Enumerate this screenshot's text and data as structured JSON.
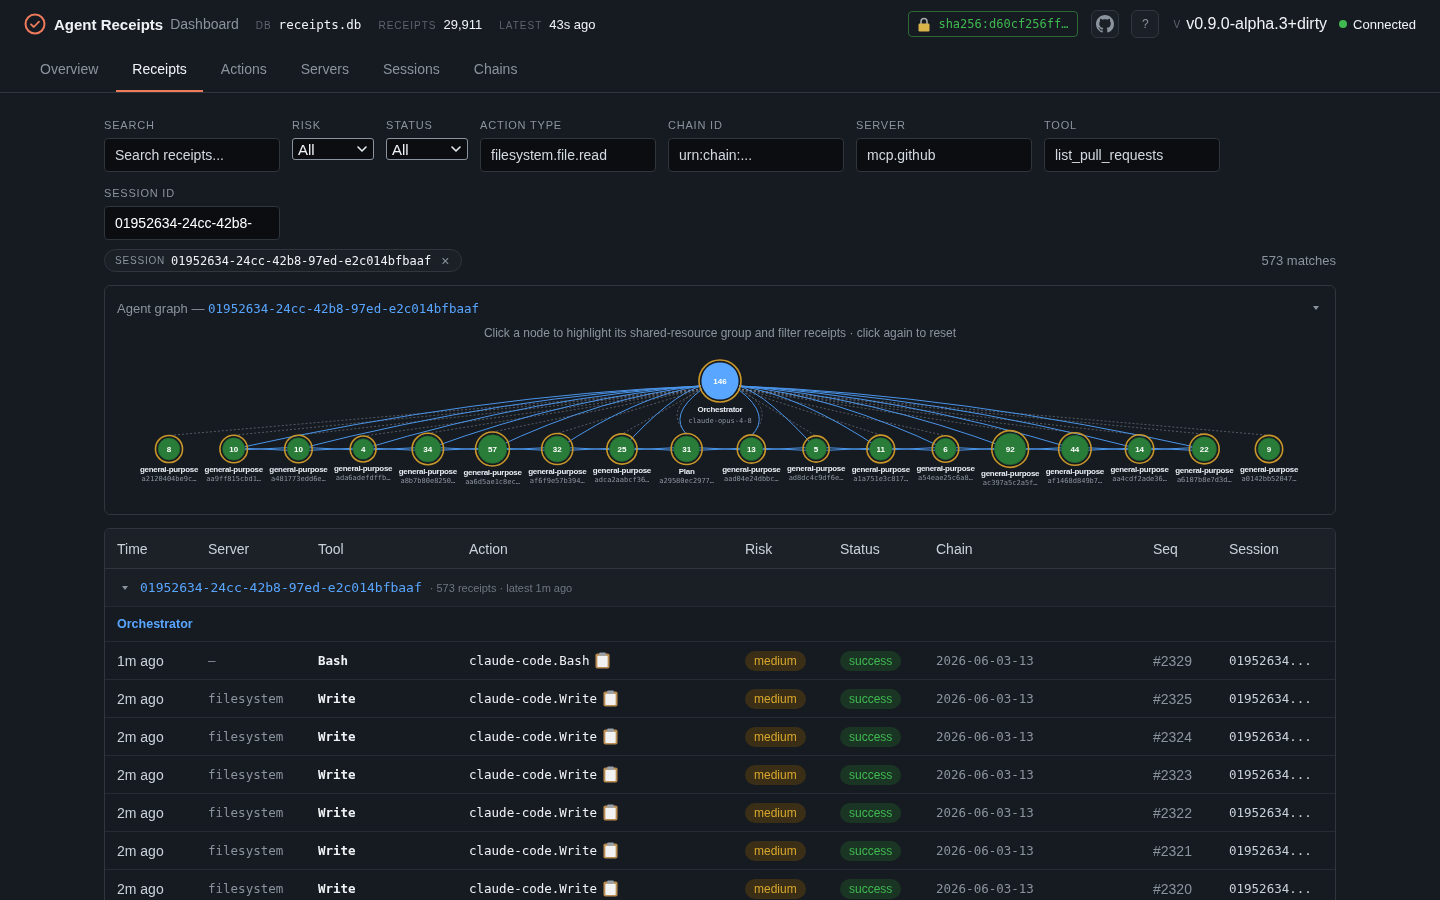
{
  "header": {
    "app_title": "Agent Receipts",
    "subtitle": "Dashboard",
    "stats": [
      {
        "label": "DB",
        "value": "receipts.db",
        "kind": "mono"
      },
      {
        "label": "RECEIPTS",
        "value": "29,911",
        "kind": "plain"
      },
      {
        "label": "LATEST",
        "value": "43s ago",
        "kind": "plain"
      }
    ],
    "hash": "sha256:d60cf256ff…",
    "help_button": "?",
    "version_label": "V",
    "version": "v0.9.0-alpha.3+dirty",
    "connection": {
      "label": "Connected",
      "connected": true
    }
  },
  "tabs": [
    {
      "label": "Overview",
      "selected": false
    },
    {
      "label": "Receipts",
      "selected": true
    },
    {
      "label": "Actions",
      "selected": false
    },
    {
      "label": "Servers",
      "selected": false
    },
    {
      "label": "Sessions",
      "selected": false
    },
    {
      "label": "Chains",
      "selected": false
    }
  ],
  "filters": [
    {
      "label": "SEARCH",
      "kind": "text",
      "placeholder": "Search receipts..."
    },
    {
      "label": "RISK",
      "kind": "select",
      "value": "All"
    },
    {
      "label": "STATUS",
      "kind": "select",
      "value": "All"
    },
    {
      "label": "ACTION TYPE",
      "kind": "text",
      "placeholder": "filesystem.file.read"
    },
    {
      "label": "CHAIN ID",
      "kind": "text",
      "placeholder": "urn:chain:..."
    },
    {
      "label": "SERVER",
      "kind": "text",
      "placeholder": "mcp.github"
    },
    {
      "label": "TOOL",
      "kind": "text",
      "placeholder": "list_pull_requests"
    },
    {
      "label": "SESSION ID",
      "kind": "text",
      "value": "01952634-24cc-42b8-"
    }
  ],
  "session_filter": {
    "label": "SESSION",
    "value": "01952634-24cc-42b8-97ed-e2c014bfbaaf",
    "remove": "×"
  },
  "match_count": "573 matches",
  "agent_graph": {
    "title": "Agent graph —",
    "session": "01952634-24cc-42b8-97ed-e2c014bfbaaf",
    "expanded": true,
    "hint": "Click a node to highlight its shared-resource group and filter receipts · click again to reset",
    "root": {
      "count": "146",
      "label": "Orchestrator",
      "model": "claude-opus-4-8"
    },
    "nodes": [
      {
        "count": "8",
        "label": "general-purpose",
        "id": "a2120404be9c…"
      },
      {
        "count": "10",
        "label": "general-purpose",
        "id": "aa9ff815cbd1…"
      },
      {
        "count": "10",
        "label": "general-purpose",
        "id": "a481773edd6e…"
      },
      {
        "count": "4",
        "label": "general-purpose",
        "id": "ada6adefdffb…"
      },
      {
        "count": "34",
        "label": "general-purpose",
        "id": "a8b7b80e8250…"
      },
      {
        "count": "57",
        "label": "general-purpose",
        "id": "aa6d5ae1c8ec…"
      },
      {
        "count": "32",
        "label": "general-purpose",
        "id": "af6f9e57b394…"
      },
      {
        "count": "25",
        "label": "general-purpose",
        "id": "adca2aabcf36…"
      },
      {
        "count": "31",
        "label": "Plan",
        "id": "a29580ec2977…"
      },
      {
        "count": "13",
        "label": "general-purpose",
        "id": "aad04e24dbbc…"
      },
      {
        "count": "5",
        "label": "general-purpose",
        "id": "ad8dc4c9df6e…"
      },
      {
        "count": "11",
        "label": "general-purpose",
        "id": "a1a751e3c817…"
      },
      {
        "count": "6",
        "label": "general-purpose",
        "id": "a54eae25c6a8…"
      },
      {
        "count": "92",
        "label": "general-purpose",
        "id": "ac397a5c2a5f…"
      },
      {
        "count": "44",
        "label": "general-purpose",
        "id": "af1468d849b7…"
      },
      {
        "count": "14",
        "label": "general-purpose",
        "id": "aa4cdf2ade36…"
      },
      {
        "count": "22",
        "label": "general-purpose",
        "id": "a6107b8e7d3d…"
      },
      {
        "count": "9",
        "label": "general-purpose",
        "id": "a0142bb52047…"
      }
    ]
  },
  "table": {
    "columns": [
      "Time",
      "Server",
      "Tool",
      "Action",
      "Risk",
      "Status",
      "Chain",
      "Seq",
      "Session"
    ],
    "groups": [
      {
        "session": "01952634-24cc-42b8-97ed-e2c014bfbaaf",
        "expanded": true,
        "meta": "· 573 receipts · latest 1m ago",
        "agents": [
          {
            "name": "Orchestrator",
            "rows": [
              {
                "time": "1m ago",
                "server": "—",
                "tool": "Bash",
                "action": "claude-code.Bash",
                "risk": "medium",
                "status": "success",
                "chain": "2026-06-03-13",
                "seq": "#2329",
                "session": "01952634..."
              },
              {
                "time": "2m ago",
                "server": "filesystem",
                "tool": "Write",
                "action": "claude-code.Write",
                "risk": "medium",
                "status": "success",
                "chain": "2026-06-03-13",
                "seq": "#2325",
                "session": "01952634..."
              },
              {
                "time": "2m ago",
                "server": "filesystem",
                "tool": "Write",
                "action": "claude-code.Write",
                "risk": "medium",
                "status": "success",
                "chain": "2026-06-03-13",
                "seq": "#2324",
                "session": "01952634..."
              },
              {
                "time": "2m ago",
                "server": "filesystem",
                "tool": "Write",
                "action": "claude-code.Write",
                "risk": "medium",
                "status": "success",
                "chain": "2026-06-03-13",
                "seq": "#2323",
                "session": "01952634..."
              },
              {
                "time": "2m ago",
                "server": "filesystem",
                "tool": "Write",
                "action": "claude-code.Write",
                "risk": "medium",
                "status": "success",
                "chain": "2026-06-03-13",
                "seq": "#2322",
                "session": "01952634..."
              },
              {
                "time": "2m ago",
                "server": "filesystem",
                "tool": "Write",
                "action": "claude-code.Write",
                "risk": "medium",
                "status": "success",
                "chain": "2026-06-03-13",
                "seq": "#2321",
                "session": "01952634..."
              },
              {
                "time": "2m ago",
                "server": "filesystem",
                "tool": "Write",
                "action": "claude-code.Write",
                "risk": "medium",
                "status": "success",
                "chain": "2026-06-03-13",
                "seq": "#2320",
                "session": "01952634..."
              }
            ]
          }
        ]
      }
    ]
  }
}
